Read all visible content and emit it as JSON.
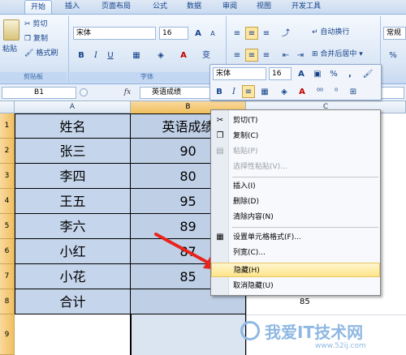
{
  "tabs": [
    "开始",
    "插入",
    "页面布局",
    "公式",
    "数据",
    "审阅",
    "视图",
    "开发工具"
  ],
  "clipboard": {
    "paste": "粘贴",
    "cut": "剪切",
    "copy": "复制",
    "format_painter": "格式刷",
    "group": "剪贴板"
  },
  "font": {
    "name": "宋体",
    "size": "16",
    "group": "字体",
    "bold": "B",
    "italic": "I",
    "underline": "U",
    "grow": "A",
    "pinyin": "变"
  },
  "alignment": {
    "wrap": "自动换行",
    "merge": "合并后居中"
  },
  "number": {
    "format": "常规",
    "percent": "%"
  },
  "mini_toolbar": {
    "font": "宋体",
    "size": "16",
    "percent": "%",
    "comma": ","
  },
  "formula_bar": {
    "name_box": "B1",
    "fx": "fx",
    "value": "英语成绩"
  },
  "columns": [
    "A",
    "B",
    "C"
  ],
  "rows": [
    {
      "num": "1",
      "a": "姓名",
      "b": "英语成绩",
      "c": ""
    },
    {
      "num": "2",
      "a": "张三",
      "b": "90",
      "c": ""
    },
    {
      "num": "3",
      "a": "李四",
      "b": "80",
      "c": ""
    },
    {
      "num": "4",
      "a": "王五",
      "b": "95",
      "c": ""
    },
    {
      "num": "5",
      "a": "李六",
      "b": "89",
      "c": ""
    },
    {
      "num": "6",
      "a": "小红",
      "b": "87",
      "c": ""
    },
    {
      "num": "7",
      "a": "小花",
      "b": "85",
      "c": ""
    },
    {
      "num": "8",
      "a": "合计",
      "b": "",
      "c": "85"
    },
    {
      "num": "9",
      "a": "",
      "b": "",
      "c": ""
    }
  ],
  "context_menu": {
    "cut": "剪切(T)",
    "copy": "复制(C)",
    "paste": "粘贴(P)",
    "paste_special": "选择性粘贴(V)...",
    "insert": "插入(I)",
    "delete": "删除(D)",
    "clear": "清除内容(N)",
    "format_cells": "设置单元格格式(F)...",
    "col_width": "列宽(C)...",
    "hide": "隐藏(H)",
    "unhide": "取消隐藏(U)"
  },
  "watermark": {
    "brand": "我爱IT技术网",
    "url": "www.52ij.com"
  },
  "colors": {
    "accent": "#f1c05e",
    "selection": "#bfcfe6",
    "arrow": "#e8231b",
    "watermark": "#8fb8e2"
  }
}
